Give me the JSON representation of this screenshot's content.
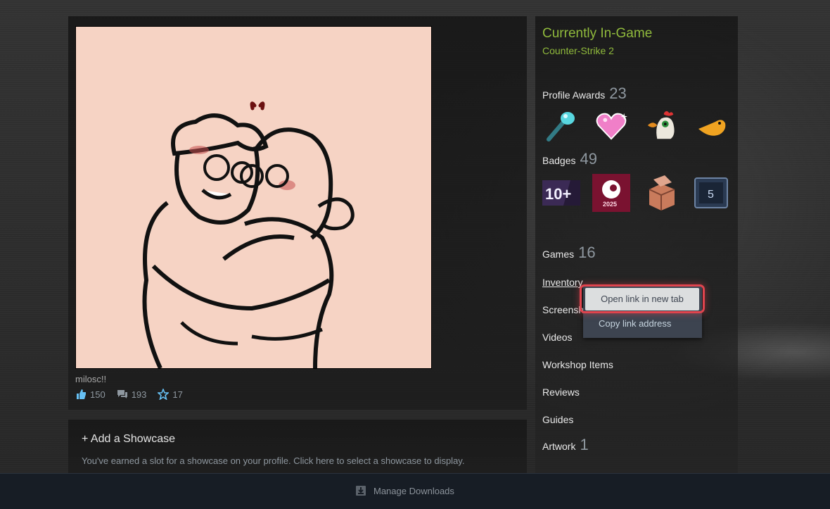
{
  "artwork": {
    "caption": "milosc!!",
    "stats": [
      {
        "icon": "thumbs-up-icon",
        "value": "150"
      },
      {
        "icon": "comment-icon",
        "value": "193"
      },
      {
        "icon": "award-star-icon",
        "value": "17"
      }
    ]
  },
  "showcase": {
    "title": "+ Add a Showcase",
    "description": "You've earned a slot for a showcase on your profile. Click here to select a showcase to display."
  },
  "status": {
    "title": "Currently In-Game",
    "game": "Counter-Strike 2"
  },
  "profile_awards": {
    "label": "Profile Awards",
    "count": "23",
    "items": [
      "comet-award-icon",
      "sparkle-heart-award-icon",
      "chicken-award-icon",
      "dino-award-icon"
    ]
  },
  "badges": {
    "label": "Badges",
    "count": "49",
    "items": [
      {
        "icon": "years-of-service-badge-icon",
        "text": "10+"
      },
      {
        "icon": "steam-2025-badge-icon",
        "text": "2025"
      },
      {
        "icon": "crate-badge-icon",
        "text": ""
      },
      {
        "icon": "level-badge-icon",
        "text": "5"
      }
    ]
  },
  "nav": {
    "games_label": "Games",
    "games_count": "16",
    "inventory": "Inventory",
    "screenshots": "Screensh",
    "videos": "Videos",
    "workshop": "Workshop Items",
    "reviews": "Reviews",
    "guides": "Guides",
    "artwork_label": "Artwork",
    "artwork_count": "1"
  },
  "context_menu": {
    "open_new_tab": "Open link in new tab",
    "copy_link": "Copy link address"
  },
  "bottom_bar": {
    "manage_downloads": "Manage Downloads"
  },
  "colors": {
    "ingame_green": "#90ba3c",
    "highlight_red": "#e0444e",
    "artwork_bg": "#f6d3c4"
  }
}
